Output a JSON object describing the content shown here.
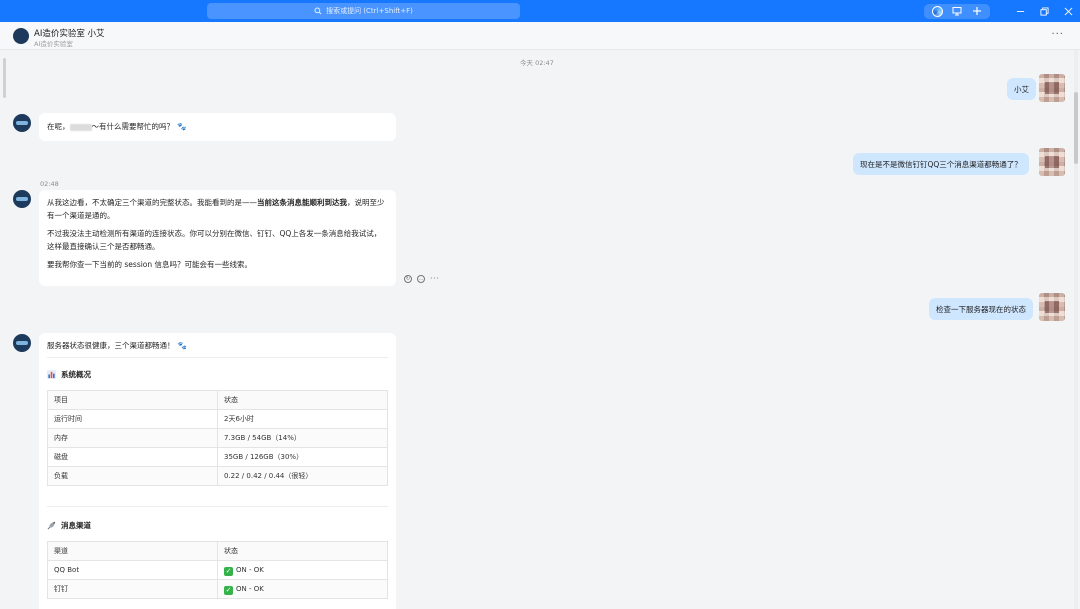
{
  "titlebar": {
    "search_placeholder": "搜索或提问 (Ctrl+Shift+F)",
    "accent": "#1677ff"
  },
  "header": {
    "title": "AI造价实验室 小艾",
    "subtitle": "AI造价实验室"
  },
  "messages": {
    "ts1": "今天 02:47",
    "user1": "小艾",
    "bot1_prefix": "在呢，",
    "bot1_suffix": "～有什么需要帮忙的吗？",
    "paw": "🐾",
    "user2": "现在是不是微信钉钉QQ三个消息渠道都畅通了？",
    "ts2": "02:48",
    "bot2_p1_a": "从我这边看，不太确定三个渠道的完整状态。我能看到的是——",
    "bot2_p1_b": "当前这条消息能顺利到达我",
    "bot2_p1_c": "，说明至少有一个渠道是通的。",
    "bot2_p2": "不过我没法主动检测所有渠道的连接状态。你可以分别在微信、钉钉、QQ上各发一条消息给我试试，这样最直接确认三个是否都畅通。",
    "bot2_p3": "要我帮你查一下当前的 session 信息吗？可能会有一些线索。",
    "user3": "检查一下服务器现在的状态",
    "bot3_intro": "服务器状态很健康，三个渠道都畅通！",
    "section1": "系统概况",
    "section2": "消息渠道"
  },
  "system_table": {
    "headers": [
      "项目",
      "状态"
    ],
    "rows": [
      [
        "运行时间",
        "2天6小时"
      ],
      [
        "内存",
        "7.3GB / 54GB（14%）"
      ],
      [
        "磁盘",
        "35GB / 126GB（30%）"
      ],
      [
        "负载",
        "0.22 / 0.42 / 0.44（很轻）"
      ]
    ]
  },
  "channel_table": {
    "headers": [
      "渠道",
      "状态"
    ],
    "rows": [
      [
        "QQ Bot",
        "ON - OK"
      ],
      [
        "钉钉",
        "ON - OK"
      ]
    ]
  }
}
